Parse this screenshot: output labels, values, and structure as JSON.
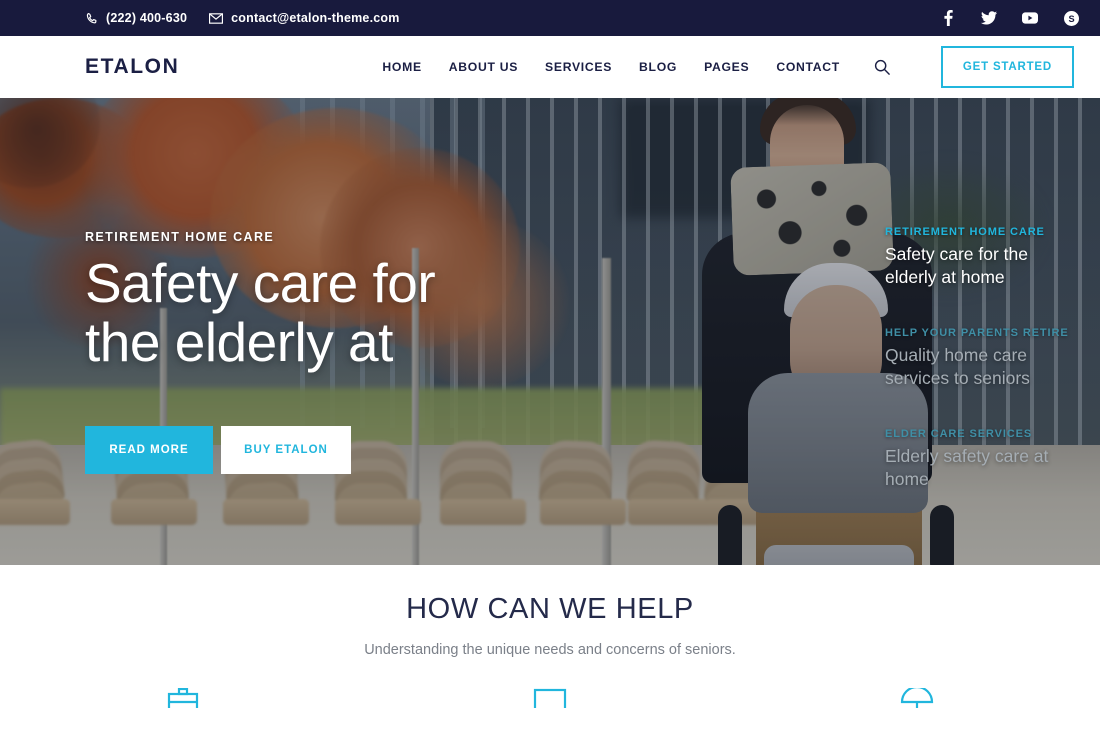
{
  "topbar": {
    "phone": "(222) 400-630",
    "email": "contact@etalon-theme.com",
    "phone_icon": "phone-icon",
    "email_icon": "envelope-icon",
    "social": [
      {
        "name": "facebook-icon",
        "glyph": "f"
      },
      {
        "name": "twitter-icon",
        "glyph": "t"
      },
      {
        "name": "youtube-icon",
        "glyph": "y"
      },
      {
        "name": "skype-icon",
        "glyph": "s"
      }
    ],
    "bg_color": "#181a3d"
  },
  "header": {
    "logo": "ETALON",
    "nav": [
      {
        "label": "HOME"
      },
      {
        "label": "ABOUT US"
      },
      {
        "label": "SERVICES"
      },
      {
        "label": "BLOG"
      },
      {
        "label": "PAGES"
      },
      {
        "label": "CONTACT"
      }
    ],
    "search_icon": "search-icon",
    "cta_label": "GET STARTED",
    "accent_color": "#21b6dd"
  },
  "hero": {
    "kicker": "RETIREMENT HOME CARE",
    "title_line1": "Safety care for",
    "title_line2": "the elderly at",
    "btn_primary": "READ MORE",
    "btn_secondary": "BUY ETALON",
    "slides": [
      {
        "kicker": "RETIREMENT HOME CARE",
        "title_line1": "Safety care for the",
        "title_line2": "elderly at home",
        "active": true
      },
      {
        "kicker": "HELP YOUR PARENTS RETIRE",
        "title_line1": "Quality home care",
        "title_line2": "services to seniors",
        "active": false
      },
      {
        "kicker": "ELDER CARE SERVICES",
        "title_line1": "Elderly safety care at",
        "title_line2": "home",
        "active": false
      }
    ]
  },
  "help": {
    "heading": "HOW CAN WE HELP",
    "subheading": "Understanding the unique needs and concerns of seniors.",
    "services": [
      {
        "icon": "briefcase-icon"
      },
      {
        "icon": "monitor-icon"
      },
      {
        "icon": "umbrella-icon"
      }
    ]
  }
}
